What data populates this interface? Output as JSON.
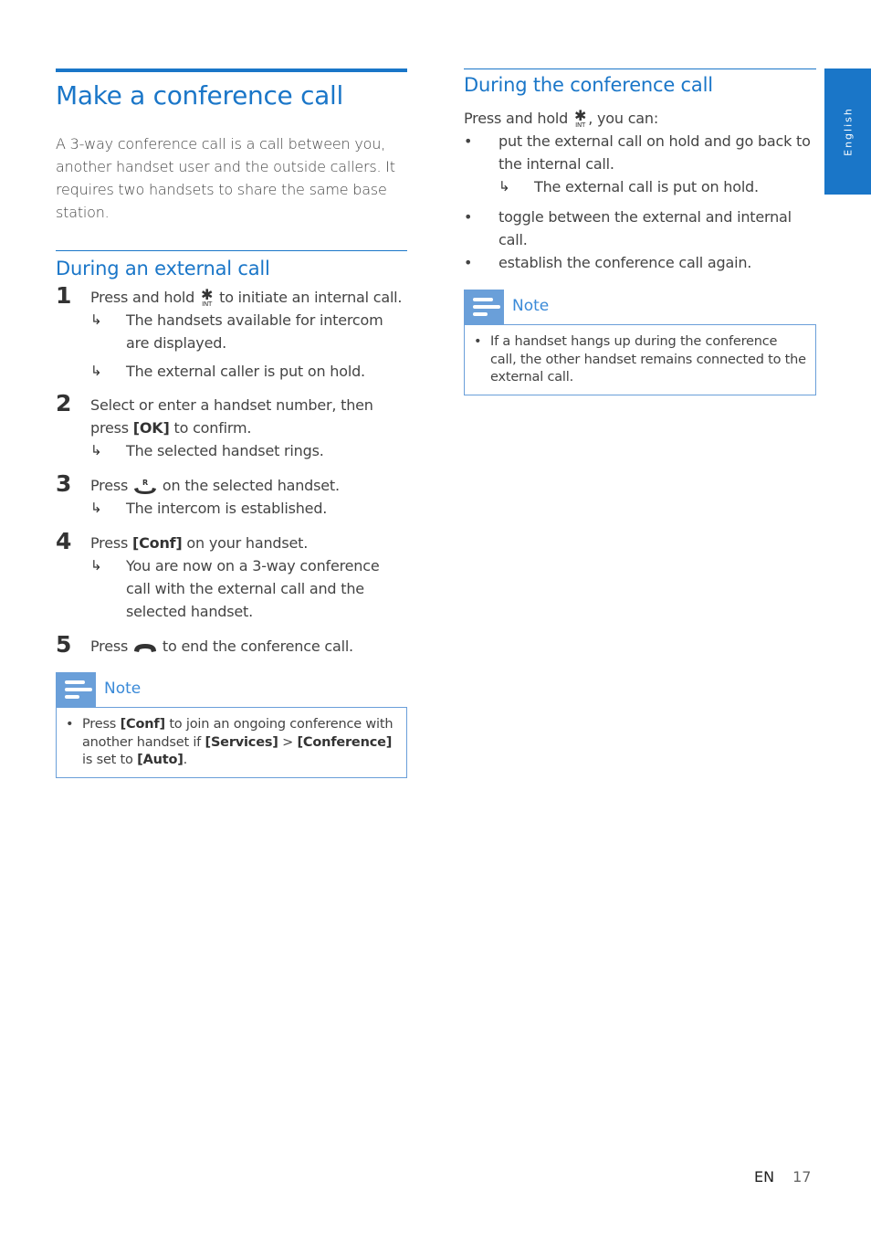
{
  "side_tab": {
    "label": "English"
  },
  "left": {
    "title": "Make a conference call",
    "intro": "A 3-way conference call is a call between you, another handset user and the outside callers. It requires two handsets to share the same base station.",
    "section_title": "During an external call",
    "steps": [
      {
        "num": "1",
        "pre": "Press and hold",
        "icon": "star-int-icon",
        "post": "to initiate an internal call.",
        "results": [
          "The handsets available for intercom are displayed.",
          "The external caller is put on hold."
        ]
      },
      {
        "num": "2",
        "pre": "Select or enter a handset number, then press",
        "key": "[OK]",
        "post": "to confirm.",
        "results": [
          "The selected handset rings."
        ]
      },
      {
        "num": "3",
        "pre": "Press",
        "icon": "recall-answer-icon",
        "post": "on the selected handset.",
        "results": [
          "The intercom is established."
        ]
      },
      {
        "num": "4",
        "pre": "Press",
        "key": "[Conf]",
        "post": "on your handset.",
        "results": [
          "You are now on a 3-way conference call with the external call and the selected handset."
        ]
      },
      {
        "num": "5",
        "pre": "Press",
        "icon": "end-call-icon",
        "post": "to end the conference call.",
        "results": []
      }
    ],
    "note": {
      "title": "Note",
      "item": {
        "t1": "Press",
        "k1": "[Conf]",
        "t2": "to join an ongoing conference with another handset if",
        "k2": "[Services]",
        "t3": ">",
        "k3": "[Conference]",
        "t4": "is set to",
        "k4": "[Auto]",
        "t5": "."
      }
    }
  },
  "right": {
    "section_title": "During the conference call",
    "intro_pre": "Press and hold",
    "intro_post": ", you can:",
    "bullets": [
      {
        "text": " put the external call on hold and go back to the internal call.",
        "result": "The external call is put on hold."
      },
      {
        "text": "toggle between the external and internal call."
      },
      {
        "text": "establish the conference call again."
      }
    ],
    "note": {
      "title": "Note",
      "item": "If a handset hangs up during the conference call, the other handset remains connected to the external call."
    }
  },
  "footer": {
    "lang": "EN",
    "page": "17"
  },
  "symbols": {
    "arrow": "↳",
    "bullet": "•",
    "star": "✱",
    "int": "INT"
  },
  "colors": {
    "accent": "#1a76c8",
    "note_accent": "#6a9fd9"
  }
}
